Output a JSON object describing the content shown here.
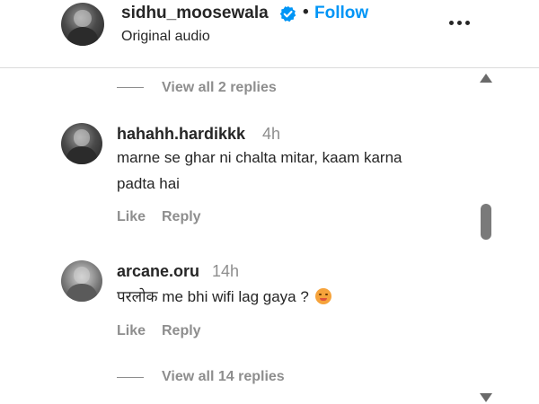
{
  "header": {
    "username": "sidhu_moosewala",
    "separator": "•",
    "follow_label": "Follow",
    "subtitle": "Original audio",
    "icons": {
      "verified": "verified-badge-icon",
      "more": "more-options-icon"
    },
    "colors": {
      "follow": "#0095f6",
      "verified": "#0095f6"
    }
  },
  "thread": {
    "view_replies_top": "View all 2 replies",
    "view_replies_bottom": "View all 14 replies"
  },
  "comments": [
    {
      "username": "hahahh.hardikkk",
      "time": "4h",
      "text": "marne se ghar ni chalta mitar, kaam karna padta hai",
      "like_label": "Like",
      "reply_label": "Reply"
    },
    {
      "username": "arcane.oru",
      "time": "14h",
      "text": "परलोक me bhi wifi lag gaya ?",
      "emoji": "pensive-face-emoji",
      "like_label": "Like",
      "reply_label": "Reply"
    }
  ],
  "scrollbar": {
    "icons": {
      "up": "scroll-up-arrow-icon",
      "down": "scroll-down-arrow-icon"
    }
  }
}
